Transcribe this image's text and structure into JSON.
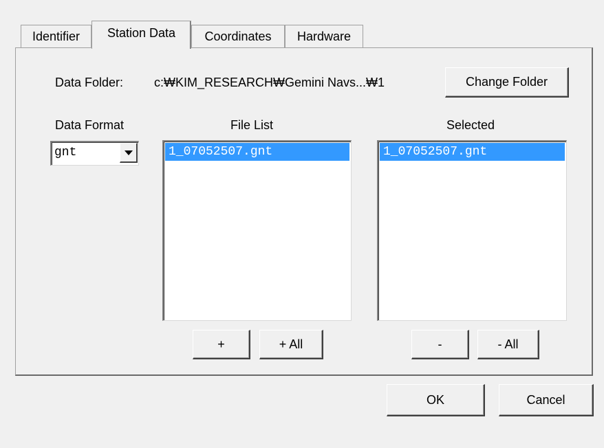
{
  "tabs": [
    {
      "label": "Identifier"
    },
    {
      "label": "Station Data"
    },
    {
      "label": "Coordinates"
    },
    {
      "label": "Hardware"
    }
  ],
  "active_tab": "Station Data",
  "data_folder": {
    "label": "Data Folder:",
    "path": "c:₩KIM_RESEARCH₩Gemini Navs...₩1",
    "change_button": "Change Folder"
  },
  "data_format": {
    "label": "Data Format",
    "value": "gnt"
  },
  "file_list": {
    "label": "File List",
    "items": [
      "1_07052507.gnt"
    ],
    "add_button": "+",
    "add_all_button": "+ All"
  },
  "selected": {
    "label": "Selected",
    "items": [
      "1_07052507.gnt"
    ],
    "remove_button": "-",
    "remove_all_button": "- All"
  },
  "footer": {
    "ok_button": "OK",
    "cancel_button": "Cancel"
  },
  "colors": {
    "selection": "#3399ff",
    "background": "#f0f0f0"
  }
}
